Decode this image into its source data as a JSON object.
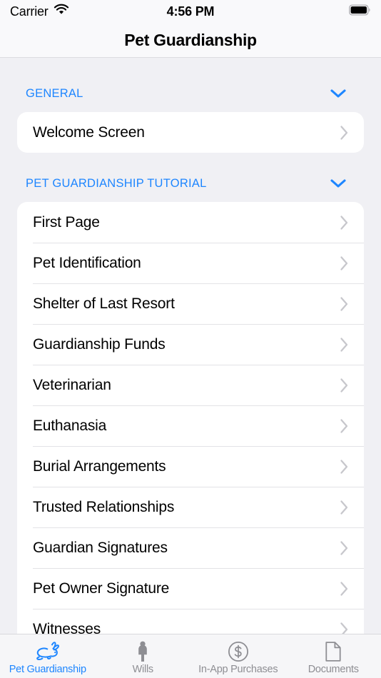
{
  "status_bar": {
    "carrier": "Carrier",
    "wifi_icon": "wifi-icon",
    "time": "4:56 PM",
    "battery_icon": "battery-full-icon"
  },
  "navigation": {
    "title": "Pet Guardianship"
  },
  "colors": {
    "accent_blue": "#1e86ff",
    "background": "#f0f0f4",
    "card": "#ffffff",
    "separator": "#e3e3e6",
    "chevron_gray": "#c7c7cc",
    "tab_inactive": "#8e8e93"
  },
  "sections": [
    {
      "title": "GENERAL",
      "collapse_icon": "chevron-down-icon",
      "rows": [
        {
          "label": "Welcome Screen",
          "accessory_icon": "chevron-right-icon"
        }
      ]
    },
    {
      "title": "PET GUARDIANSHIP TUTORIAL",
      "collapse_icon": "chevron-down-icon",
      "rows": [
        {
          "label": "First Page",
          "accessory_icon": "chevron-right-icon"
        },
        {
          "label": "Pet Identification",
          "accessory_icon": "chevron-right-icon"
        },
        {
          "label": "Shelter of Last Resort",
          "accessory_icon": "chevron-right-icon"
        },
        {
          "label": "Guardianship Funds",
          "accessory_icon": "chevron-right-icon"
        },
        {
          "label": "Veterinarian",
          "accessory_icon": "chevron-right-icon"
        },
        {
          "label": "Euthanasia",
          "accessory_icon": "chevron-right-icon"
        },
        {
          "label": "Burial Arrangements",
          "accessory_icon": "chevron-right-icon"
        },
        {
          "label": "Trusted Relationships",
          "accessory_icon": "chevron-right-icon"
        },
        {
          "label": "Guardian Signatures",
          "accessory_icon": "chevron-right-icon"
        },
        {
          "label": "Pet Owner Signature",
          "accessory_icon": "chevron-right-icon"
        },
        {
          "label": "Witnesses",
          "accessory_icon": "chevron-right-icon"
        }
      ]
    }
  ],
  "tab_bar": {
    "tabs": [
      {
        "label": "Pet Guardianship",
        "icon": "rabbit-icon",
        "active": true
      },
      {
        "label": "Wills",
        "icon": "person-icon",
        "active": false
      },
      {
        "label": "In-App Purchases",
        "icon": "dollar-circle-icon",
        "active": false
      },
      {
        "label": "Documents",
        "icon": "document-icon",
        "active": false
      }
    ]
  }
}
